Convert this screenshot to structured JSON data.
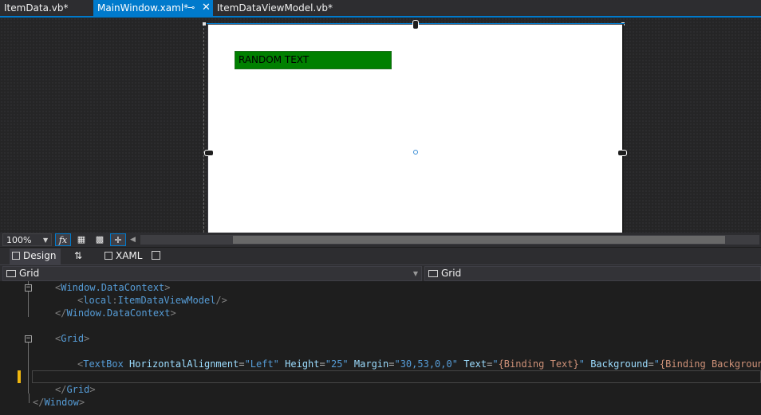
{
  "tabs": [
    {
      "label": "ItemData.vb*",
      "active": false
    },
    {
      "label": "MainWindow.xaml*",
      "active": true
    },
    {
      "label": "ItemDataViewModel.vb*",
      "active": false
    }
  ],
  "tab_icons": {
    "pin": "pin-icon",
    "close": "close-icon"
  },
  "designer": {
    "preview_textbox_text": "RANDOM TEXT",
    "preview_textbox_color": "#008000",
    "window_background": "#ffffff"
  },
  "zoombar": {
    "zoom": "100%",
    "fx": "fx"
  },
  "view_tabs": {
    "design": "Design",
    "swap": "⇅",
    "xaml": "XAML"
  },
  "navbar": {
    "left": "Grid",
    "right": "Grid"
  },
  "code": {
    "l1_tag": "Window.DataContext",
    "l2_prefix": "local",
    "l2_tag": "ItemDataViewModel",
    "l3_tag": "Window.DataContext",
    "l5_tag": "Grid",
    "l7_tag": "TextBox",
    "l7_a1": "HorizontalAlignment",
    "l7_v1": "\"Left\"",
    "l7_a2": "Height",
    "l7_v2": "\"25\"",
    "l7_a3": "Margin",
    "l7_v3": "\"30,53,0,0\"",
    "l7_a4": "Text",
    "l7_v4q": "\"",
    "l7_v4": "{Binding Text}",
    "l7_a5": "Background",
    "l7_v5": "{Binding Background}",
    "l9_tag": "Grid",
    "l10_tag": "Window"
  },
  "colors": {
    "accent": "#007acc",
    "change_marker": "#efb60f"
  }
}
